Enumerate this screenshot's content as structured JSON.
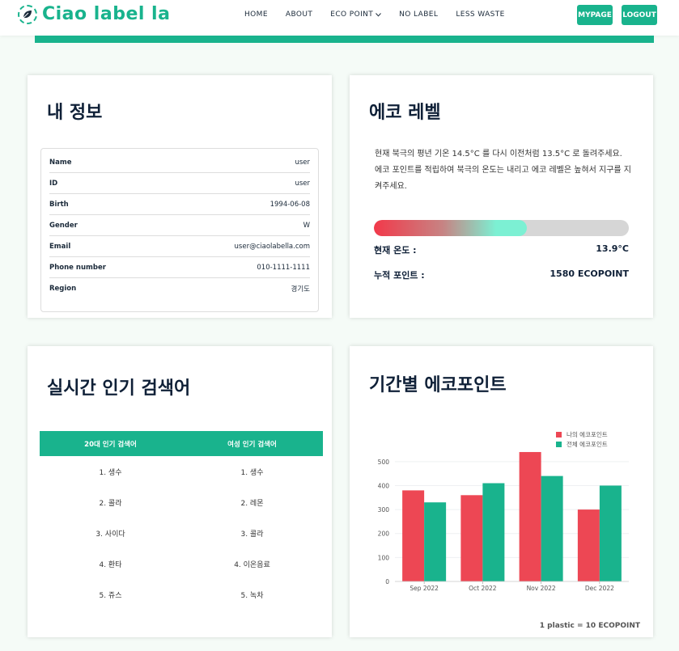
{
  "brand": {
    "name": "Ciao label la",
    "accent": "#19b38d"
  },
  "nav": {
    "items": [
      {
        "label": "HOME"
      },
      {
        "label": "ABOUT"
      },
      {
        "label": "ECO POINT",
        "has_dropdown": true
      },
      {
        "label": "NO LABEL"
      },
      {
        "label": "LESS WASTE"
      }
    ],
    "mypage_label": "MYPAGE",
    "logout_label": "LOGOUT"
  },
  "info": {
    "title": "내 정보",
    "rows": [
      {
        "label": "Name",
        "value": "user"
      },
      {
        "label": "ID",
        "value": "user"
      },
      {
        "label": "Birth",
        "value": "1994-06-08"
      },
      {
        "label": "Gender",
        "value": "W"
      },
      {
        "label": "Email",
        "value": "user@ciaolabella.com"
      },
      {
        "label": "Phone number",
        "value": "010-1111-1111"
      },
      {
        "label": "Region",
        "value": "경기도"
      }
    ]
  },
  "eco": {
    "title": "에코 레벨",
    "description": "현재 북극의 평년 기온 14.5°C 를 다시 이전처럼 13.5°C 로 돌려주세요. 에코 포인트를 적립하여 북극의 온도는 내리고 에코 레벨은 높혀서 지구를 지켜주세요.",
    "progress_percent": 60,
    "current_temp_label": "현재 온도 :",
    "current_temp_value": "13.9°C",
    "points_label": "누적 포인트 :",
    "points_value": "1580 ECOPOINT"
  },
  "search": {
    "title": "실시간 인기 검색어",
    "headers": [
      "20대 인기 검색어",
      "여성 인기 검색어"
    ],
    "rows": [
      [
        "1. 생수",
        "1. 생수"
      ],
      [
        "2. 콜라",
        "2. 레몬"
      ],
      [
        "3. 사이다",
        "3. 콜라"
      ],
      [
        "4. 환타",
        "4. 이온음료"
      ],
      [
        "5. 쥬스",
        "5. 녹차"
      ]
    ]
  },
  "chart_title": "기간별 에코포인트",
  "chart_note": "1 plastic = 10 ECOPOINT",
  "chart_data": {
    "type": "bar",
    "categories": [
      "Sep 2022",
      "Oct 2022",
      "Nov 2022",
      "Dec 2022"
    ],
    "series": [
      {
        "name": "나의 에코포인트",
        "values": [
          380,
          360,
          540,
          300
        ],
        "color": "#ed4754"
      },
      {
        "name": "전체 에코포인트",
        "values": [
          330,
          410,
          440,
          400
        ],
        "color": "#19b38d"
      }
    ],
    "ylim": [
      0,
      550
    ],
    "yticks": [
      0,
      100,
      200,
      300,
      400,
      500
    ],
    "grid": true,
    "legend": "top-right"
  }
}
